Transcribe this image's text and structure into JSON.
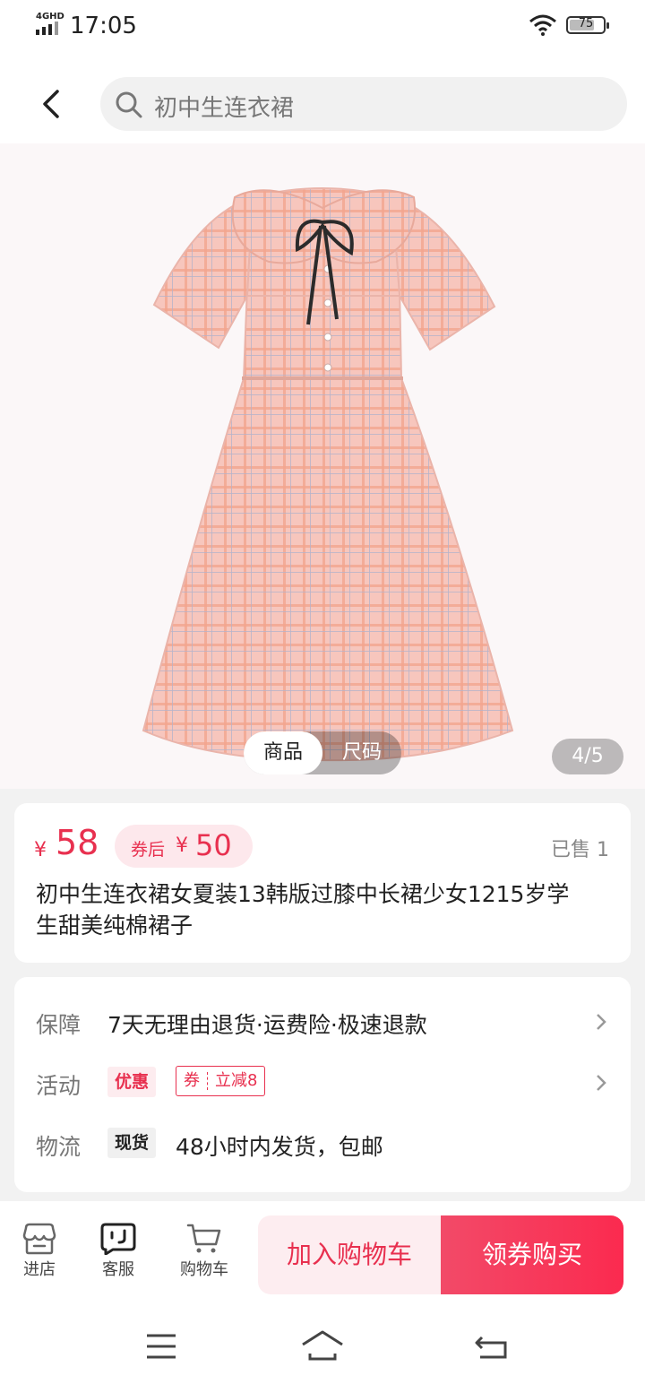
{
  "status_bar": {
    "network": "4GHD",
    "time": "17:05",
    "battery": "75",
    "battery_level": 0.75
  },
  "search": {
    "query": "初中生连衣裙"
  },
  "gallery": {
    "tabs": [
      "商品",
      "尺码"
    ],
    "active_tab": "商品",
    "page_indicator": "4/5"
  },
  "product": {
    "currency": "¥",
    "price": "58",
    "coupon_label": "券后",
    "coupon_price": "50",
    "sold": "已售 1",
    "title": "初中生连衣裙女夏装13韩版过膝中长裙少女1215岁学生甜美纯棉裙子"
  },
  "info": {
    "guarantee": {
      "label": "保障",
      "text": "7天无理由退货·运费险·极速退款"
    },
    "activity": {
      "label": "活动",
      "tag": "优惠",
      "coupon_prefix": "券",
      "coupon_text": "立减8"
    },
    "logistics": {
      "label": "物流",
      "tag": "现货",
      "text": "48小时内发货，包邮"
    }
  },
  "bottom_bar": {
    "store": "进店",
    "service": "客服",
    "cart": "购物车",
    "add_to_cart": "加入购物车",
    "buy": "领券购买"
  },
  "colors": {
    "accent": "#e8304f",
    "accent_light": "#fdedf0"
  },
  "icons": [
    "back-arrow-icon",
    "search-icon",
    "store-icon",
    "customer-service-icon",
    "cart-icon",
    "menu-icon",
    "home-icon",
    "return-icon",
    "wifi-icon",
    "battery-icon",
    "signal-icon",
    "chevron-right-icon"
  ]
}
